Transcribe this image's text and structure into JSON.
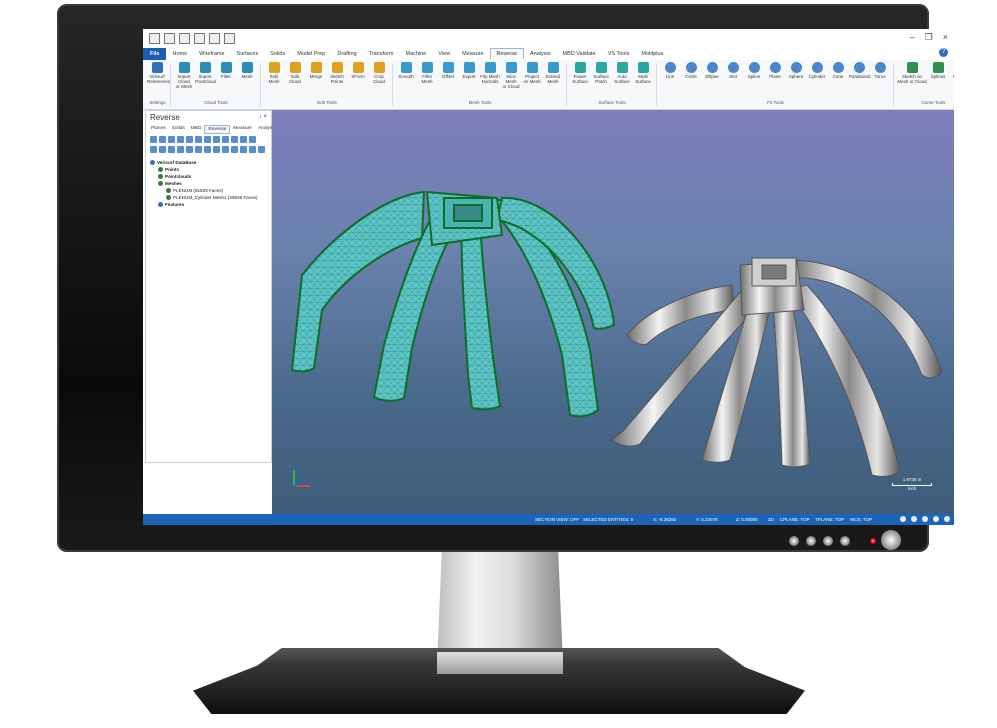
{
  "menu": {
    "file": "File",
    "tabs": [
      "Home",
      "Wireframe",
      "Surfaces",
      "Solids",
      "Model Prep",
      "Drafting",
      "Transform",
      "Machine",
      "View",
      "Measure",
      "Reverse",
      "Analysis",
      "MBD Validate",
      "VS Tools",
      "Moldplus"
    ],
    "active": "Reverse"
  },
  "ribbon": {
    "tools": [
      {
        "label": "Verisurf\nReferences",
        "group": "settings"
      },
      {
        "label": "Import Cloud\nor Mesh",
        "group": "cloud"
      },
      {
        "label": "Import\nPointcloud",
        "group": "cloud"
      },
      {
        "label": "Filter",
        "group": "cloud"
      },
      {
        "label": "Mesh",
        "group": "cloud"
      },
      {
        "label": "Edit\nMesh",
        "group": "edit"
      },
      {
        "label": "Edit\nCloud",
        "group": "edit"
      },
      {
        "label": "Merge",
        "group": "edit"
      },
      {
        "label": "Sketch\nPoints",
        "group": "edit"
      },
      {
        "label": "XForm",
        "group": "edit"
      },
      {
        "label": "Crop\nCloud",
        "group": "edit"
      },
      {
        "label": "Smooth",
        "group": "meshtools"
      },
      {
        "label": "Fillet\nMesh",
        "group": "meshtools"
      },
      {
        "label": "Offset",
        "group": "meshtools"
      },
      {
        "label": "Export",
        "group": "meshtools"
      },
      {
        "label": "Flip Mesh\nNormals",
        "group": "meshtools"
      },
      {
        "label": "Slice Mesh\nor Cloud",
        "group": "meshtools"
      },
      {
        "label": "Project\non Mesh",
        "group": "meshtools"
      },
      {
        "label": "Extend\nMesh",
        "group": "meshtools"
      },
      {
        "label": "Power\nSurface",
        "group": "surface"
      },
      {
        "label": "Surface\nPatch",
        "group": "surface"
      },
      {
        "label": "Auto\nSurface",
        "group": "surface"
      },
      {
        "label": "Multi\nSurface",
        "group": "surface"
      },
      {
        "label": "Line",
        "group": "fit"
      },
      {
        "label": "Circle",
        "group": "fit"
      },
      {
        "label": "Ellipse",
        "group": "fit"
      },
      {
        "label": "Slot",
        "group": "fit"
      },
      {
        "label": "Spline",
        "group": "fit"
      },
      {
        "label": "Plane",
        "group": "fit"
      },
      {
        "label": "Sphere",
        "group": "fit"
      },
      {
        "label": "Cylinder",
        "group": "fit"
      },
      {
        "label": "Cone",
        "group": "fit"
      },
      {
        "label": "Paraboloid",
        "group": "fit"
      },
      {
        "label": "Torus",
        "group": "fit"
      },
      {
        "label": "Sketch on\nMesh or Cloud",
        "group": "curve"
      },
      {
        "label": "Splines",
        "group": "curve"
      },
      {
        "label": "Curve\nFill",
        "group": "curve"
      }
    ],
    "groups": {
      "settings": "Settings",
      "cloud": "Cloud Tools",
      "edit": "Edit Tools",
      "meshtools": "Mesh Tools",
      "surface": "Surface Tools",
      "fit": "Fit Tools",
      "curve": "Curve Tools"
    }
  },
  "panel": {
    "title": "Reverse",
    "pin": "↓ ×",
    "tabs": [
      "Planes",
      "Solids",
      "MBD",
      "Reverse",
      "Measure",
      "Analysis"
    ],
    "active_tab": "Reverse",
    "tree": [
      {
        "label": "Verisurf DataBase",
        "level": 0
      },
      {
        "label": "Points",
        "level": 1
      },
      {
        "label": "Pointclouds",
        "level": 1
      },
      {
        "label": "Meshes",
        "level": 1
      },
      {
        "label": "PLENUM (81829 Faces)",
        "level": 2
      },
      {
        "label": "PLENUM_Cylinder Mesh1 (25826 Faces)",
        "level": 2
      },
      {
        "label": "Features",
        "level": 1
      }
    ]
  },
  "viewport": {
    "scale_label": "1.9736 in",
    "scale_unit": "Inch"
  },
  "status": {
    "section_view": "SECTION VIEW: OFF",
    "selected": "SELECTED ENTITIES: 0",
    "x": "X: -8.38392",
    "y": "Y: 5.22079",
    "z": "Z: 0.00000",
    "mode": "3D",
    "cplane": "CPLANE: TOP",
    "tplane": "TPLANE: TOP",
    "wcs": "WCS: TOP"
  },
  "colors": {
    "accent": "#1c64b7",
    "mesh": "#5ec4c4",
    "viewport_top": "#7d7dbb",
    "viewport_bottom": "#3e5c7a"
  }
}
